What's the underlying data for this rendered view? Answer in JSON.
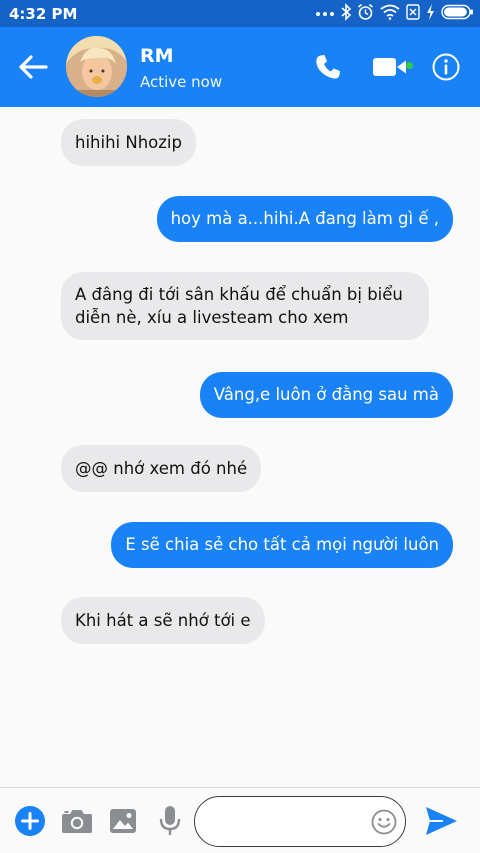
{
  "status_bar": {
    "time": "4:32 PM",
    "icons": [
      "dots-icon",
      "bluetooth-icon",
      "alarm-icon",
      "wifi-icon",
      "sim-off-icon",
      "charging-icon",
      "battery-icon"
    ],
    "battery_level": 0.95
  },
  "header": {
    "contact_name": "RM",
    "status": "Active now",
    "online": true,
    "icons": [
      "back-arrow-icon",
      "phone-icon",
      "video-camera-icon",
      "info-icon"
    ]
  },
  "messages": [
    {
      "direction": "incoming",
      "text": "hihihi Nhozip"
    },
    {
      "direction": "outgoing",
      "text": "hoy mà a...hihi.A đang làm gì ế ,"
    },
    {
      "direction": "incoming",
      "text": "A đâng đi tới sân khấu để chuẩn bị biểu\ndiễn nè, xíu a livesteam cho xem"
    },
    {
      "direction": "outgoing",
      "text": "Vâng,e luôn ở đằng sau mà"
    },
    {
      "direction": "incoming",
      "text": "@@ nhớ xem đó nhé"
    },
    {
      "direction": "outgoing",
      "text": "E sẽ chia sẻ cho tất cả mọi người luôn"
    },
    {
      "direction": "incoming",
      "text": "Khi hát a sẽ nhớ tới e"
    }
  ],
  "composer": {
    "input_value": "",
    "input_placeholder": "",
    "icons": [
      "plus-icon",
      "camera-icon",
      "gallery-icon",
      "microphone-icon",
      "emoji-icon",
      "send-icon"
    ]
  },
  "colors": {
    "status_bar": "#1563c6",
    "header": "#1a82f7",
    "outgoing_bubble": "#1a82f7",
    "incoming_bubble": "#e9e9eb",
    "online_dot": "#31cc46"
  }
}
